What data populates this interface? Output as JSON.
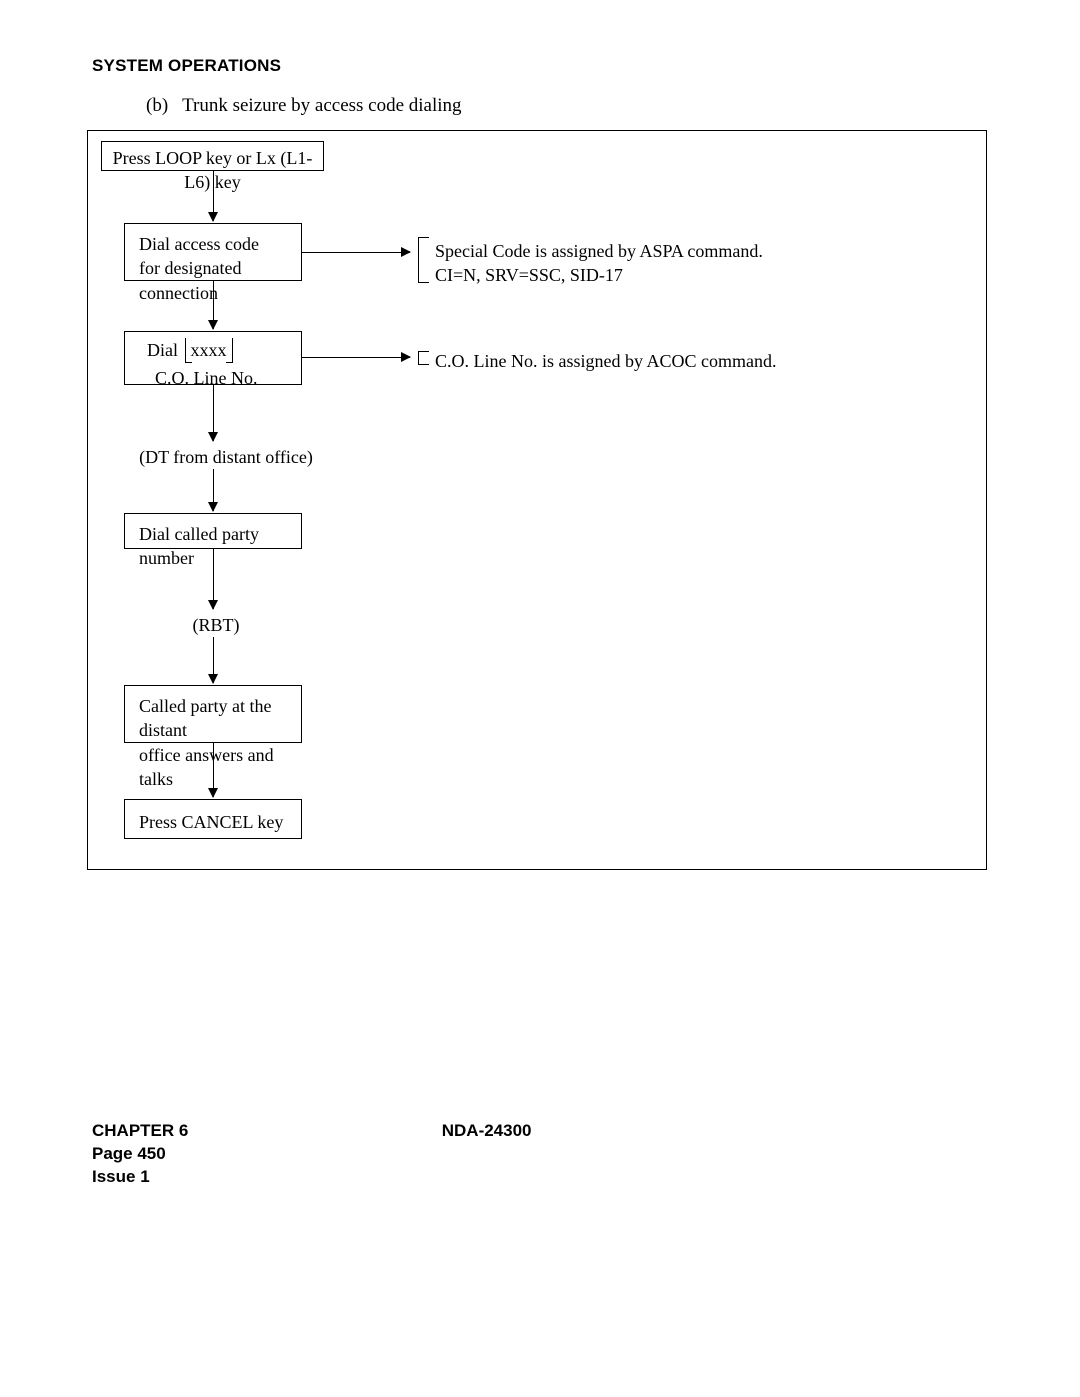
{
  "header": "SYSTEM OPERATIONS",
  "subtitle_prefix": "(b)",
  "subtitle_text": "Trunk seizure by access code dialing",
  "flow": {
    "step1": "Press LOOP key or Lx (L1-L6) key",
    "step2_line1": "Dial access code",
    "step2_line2": "for designated connection",
    "step3_dial": "Dial",
    "step3_placeholder": "xxxx",
    "step3_sub": "C.O. Line No.",
    "step4_midtext": "(DT from distant office)",
    "step5": "Dial called party number",
    "step6_midtext": "(RBT)",
    "step7_line1": "Called party at the distant",
    "step7_line2": "office answers and talks",
    "step8": "Press CANCEL key"
  },
  "notes": {
    "note1_line1": "Special Code is assigned by ASPA command.",
    "note1_line2": "CI=N, SRV=SSC, SID-17",
    "note2": "C.O. Line No. is assigned by ACOC command."
  },
  "footer": {
    "chapter": "CHAPTER 6",
    "page": "Page 450",
    "issue": "Issue 1",
    "docid": "NDA-24300"
  }
}
